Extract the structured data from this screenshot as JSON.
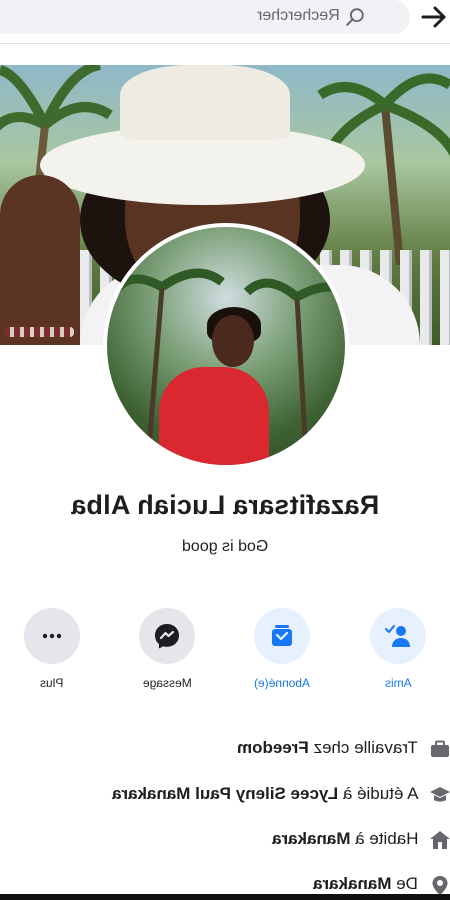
{
  "search": {
    "label": "Rechercher"
  },
  "profile": {
    "name": "Razafitsara Luciah Alba",
    "bio": "God is good"
  },
  "actions": [
    {
      "label": "Amis",
      "icon": "add-friend-icon"
    },
    {
      "label": "Abonné(e)",
      "icon": "following-icon"
    },
    {
      "label": "Message",
      "icon": "messenger-icon"
    },
    {
      "label": "Plus",
      "icon": "more-icon"
    }
  ],
  "info": [
    {
      "prefix": "Travaille chez ",
      "bold": "Freedom",
      "icon": "briefcase-icon"
    },
    {
      "prefix": "A étudié à ",
      "bold": "Lycee Sileny Paul Manakara",
      "icon": "graduation-cap-icon"
    },
    {
      "prefix": "Habite à ",
      "bold": "Manakara",
      "icon": "home-icon"
    },
    {
      "prefix": "De ",
      "bold": "Manakara",
      "icon": "location-pin-icon"
    }
  ],
  "colors": {
    "accent": "#1877f2",
    "text": "#1c1e21",
    "muted": "#65676b",
    "button_grey": "#e4e6eb"
  }
}
